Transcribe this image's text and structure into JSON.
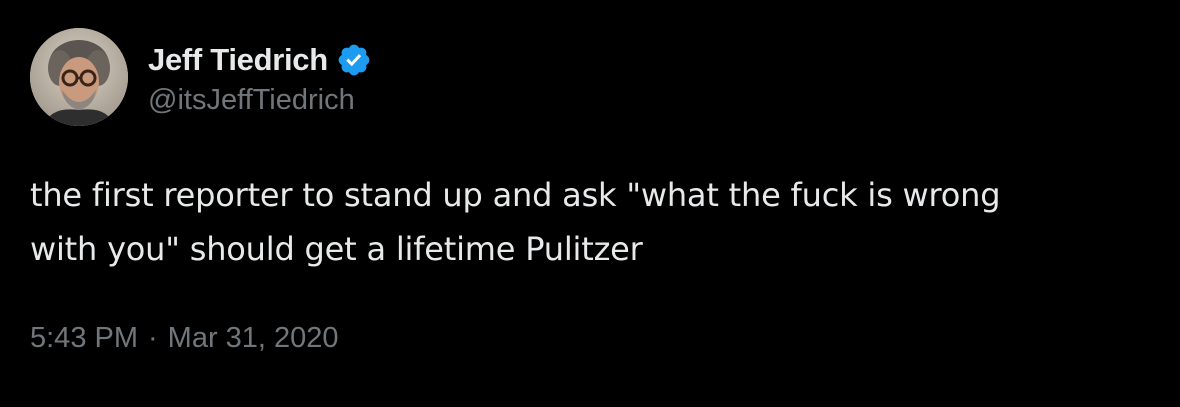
{
  "author": {
    "display_name": "Jeff Tiedrich",
    "handle": "@itsJeffTiedrich",
    "verified": true,
    "avatar_icon": "avatar-photo"
  },
  "tweet": {
    "text": "the first reporter to stand up and ask \"what the fuck is wrong\nwith you\" should get a lifetime Pulitzer",
    "time": "5:43 PM",
    "separator": "·",
    "date": "Mar 31, 2020"
  },
  "colors": {
    "background": "#000000",
    "primary_text": "#e7e9ea",
    "secondary_text": "#71767b",
    "verified_badge": "#1d9bf0"
  }
}
